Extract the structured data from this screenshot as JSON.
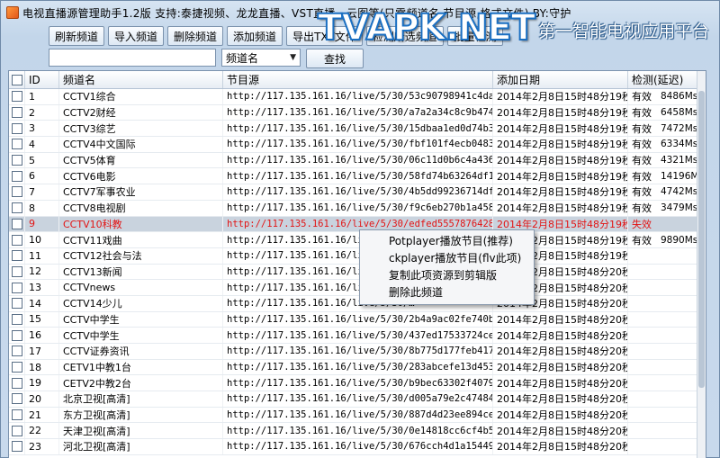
{
  "window": {
    "title": "电视直播源管理助手1.2版  支持:泰捷视频、龙龙直播、VST直播、云图等(只需频道名,节目源,格式文件) BY:守护",
    "accent_color": "#1a6fc2"
  },
  "watermark": {
    "brand": "TVAPK.NET",
    "tagline": "第一智能电视应用平台"
  },
  "toolbar": {
    "buttons": [
      "刷新频道",
      "导入频道",
      "删除频道",
      "添加频道",
      "导出TXT文件",
      "检测所选频道",
      "批量检测"
    ]
  },
  "search": {
    "value": "",
    "field_selected": "频道名",
    "find_label": "查找"
  },
  "grid": {
    "columns": [
      "ID",
      "频道名",
      "节目源",
      "添加日期",
      "检测(延迟)"
    ],
    "rows": [
      {
        "id": "1",
        "name": "CCTV1综合",
        "src": "http://117.135.161.16/live/5/30/53c90798941c4dad…",
        "date": "2014年2月8日15时48分19秒",
        "status": "有效",
        "ms": "8486Ms"
      },
      {
        "id": "2",
        "name": "CCTV2财经",
        "src": "http://117.135.161.16/live/5/30/a7a2a34c8c9b4740…",
        "date": "2014年2月8日15时48分19秒",
        "status": "有效",
        "ms": "6458Ms"
      },
      {
        "id": "3",
        "name": "CCTV3综艺",
        "src": "http://117.135.161.16/live/5/30/15dbaa1ed0d74b3c…",
        "date": "2014年2月8日15时48分19秒",
        "status": "有效",
        "ms": "7472Ms"
      },
      {
        "id": "4",
        "name": "CCTV4中文国际",
        "src": "http://117.135.161.16/live/5/30/fbf101f4ecb04836…",
        "date": "2014年2月8日15时48分19秒",
        "status": "有效",
        "ms": "6334Ms"
      },
      {
        "id": "5",
        "name": "CCTV5体育",
        "src": "http://117.135.161.16/live/5/30/06c11d0b6c4a436e…",
        "date": "2014年2月8日15时48分19秒",
        "status": "有效",
        "ms": "4321Ms"
      },
      {
        "id": "6",
        "name": "CCTV6电影",
        "src": "http://117.135.161.16/live/5/30/58fd74b63264df1…",
        "date": "2014年2月8日15时48分19秒",
        "status": "有效",
        "ms": "14196Ms"
      },
      {
        "id": "7",
        "name": "CCTV7军事农业",
        "src": "http://117.135.161.16/live/5/30/4b5dd99236714df5…",
        "date": "2014年2月8日15时48分19秒",
        "status": "有效",
        "ms": "4742Ms"
      },
      {
        "id": "8",
        "name": "CCTV8电视剧",
        "src": "http://117.135.161.16/live/5/30/f9c6eb270b1a4587…",
        "date": "2014年2月8日15时48分19秒",
        "status": "有效",
        "ms": "3479Ms"
      },
      {
        "id": "9",
        "name": "CCTV10科教",
        "src": "http://117.135.161.16/live/5/30/edfed5557876428f…",
        "date": "2014年2月8日15时48分19秒",
        "status": "失效",
        "ms": "",
        "selected": true
      },
      {
        "id": "10",
        "name": "CCTV11戏曲",
        "src": "http://117.135.161.16/live/5/30/…",
        "date": "2014年2月8日15时48分19秒",
        "status": "有效",
        "ms": "9890Ms"
      },
      {
        "id": "11",
        "name": "CCTV12社会与法",
        "src": "http://117.135.161.16/live/5/30/…",
        "date": "2014年2月8日15时48分19秒",
        "status": "",
        "ms": ""
      },
      {
        "id": "12",
        "name": "CCTV13新闻",
        "src": "http://117.135.161.16/live/5/30/…",
        "date": "2014年2月8日15时48分20秒",
        "status": "",
        "ms": ""
      },
      {
        "id": "13",
        "name": "CCTVnews",
        "src": "http://117.135.161.16/live/5/30/…",
        "date": "2014年2月8日15时48分20秒",
        "status": "",
        "ms": ""
      },
      {
        "id": "14",
        "name": "CCTV14少儿",
        "src": "http://117.135.161.16/live/5/30/…",
        "date": "2014年2月8日15时48分20秒",
        "status": "",
        "ms": ""
      },
      {
        "id": "15",
        "name": "CCTV中学生",
        "src": "http://117.135.161.16/live/5/30/2b4a9ac02fe740b4…",
        "date": "2014年2月8日15时48分20秒",
        "status": "",
        "ms": ""
      },
      {
        "id": "16",
        "name": "CCTV中学生",
        "src": "http://117.135.161.16/live/5/30/437ed17533724ce1…",
        "date": "2014年2月8日15时48分20秒",
        "status": "",
        "ms": ""
      },
      {
        "id": "17",
        "name": "CCTV证券资讯",
        "src": "http://117.135.161.16/live/5/30/8b775d177feb417d…",
        "date": "2014年2月8日15时48分20秒",
        "status": "",
        "ms": ""
      },
      {
        "id": "18",
        "name": "CETV1中教1台",
        "src": "http://117.135.161.16/live/5/30/283abcefe13d4536…",
        "date": "2014年2月8日15时48分20秒",
        "status": "",
        "ms": ""
      },
      {
        "id": "19",
        "name": "CETV2中教2台",
        "src": "http://117.135.161.16/live/5/30/b9bec63302f4079…",
        "date": "2014年2月8日15时48分20秒",
        "status": "",
        "ms": ""
      },
      {
        "id": "20",
        "name": "北京卫视[高清]",
        "src": "http://117.135.161.16/live/5/30/d005a79e2c474848…",
        "date": "2014年2月8日15时48分20秒",
        "status": "",
        "ms": ""
      },
      {
        "id": "21",
        "name": "东方卫视[高清]",
        "src": "http://117.135.161.16/live/5/30/887d4d23ee894ceb…",
        "date": "2014年2月8日15时48分20秒",
        "status": "",
        "ms": ""
      },
      {
        "id": "22",
        "name": "天津卫视[高清]",
        "src": "http://117.135.161.16/live/5/30/0e14818cc6cf4b5e…",
        "date": "2014年2月8日15时48分20秒",
        "status": "",
        "ms": ""
      },
      {
        "id": "23",
        "name": "河北卫视[高清]",
        "src": "http://117.135.161.16/live/5/30/676cch4d1a154499…",
        "date": "2014年2月8日15时48分20秒",
        "status": "",
        "ms": ""
      }
    ],
    "selected_color": "#e21414"
  },
  "context_menu": {
    "items": [
      "Potplayer播放节目(推荐)",
      "ckplayer播放节目(flv此项)",
      "复制此项资源到剪辑版",
      "删除此频道"
    ]
  }
}
